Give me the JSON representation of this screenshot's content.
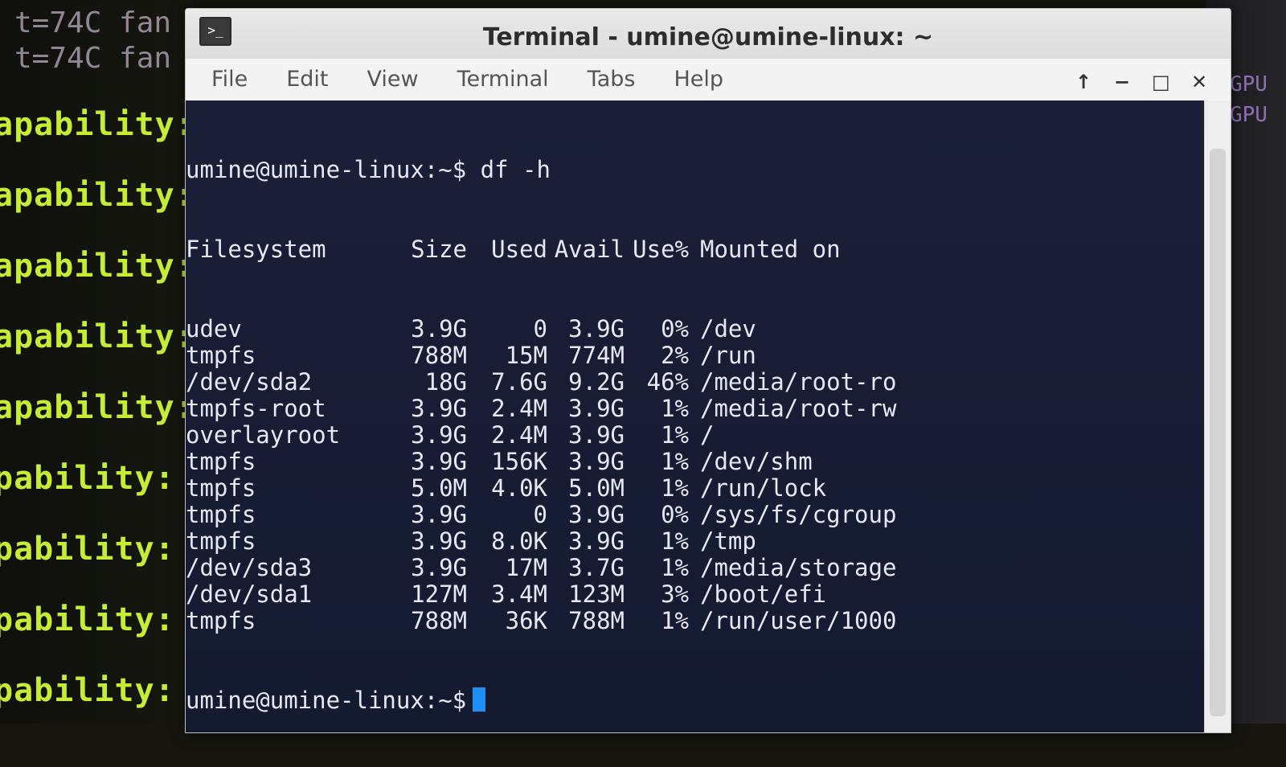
{
  "background": {
    "top_lines": [
      "t=74C fan",
      "t=74C fan"
    ],
    "capability_lines": [
      "apability:",
      "apability:",
      "apability:",
      "apability:",
      "apability:",
      "pability:",
      "pability:",
      "pability:",
      "pability:"
    ],
    "right_text": [
      "GPU",
      "GPU"
    ]
  },
  "window": {
    "title": "Terminal - umine@umine-linux: ~",
    "controls": [
      "↑",
      "−",
      "□",
      "✕"
    ],
    "menu": [
      "File",
      "Edit",
      "View",
      "Terminal",
      "Tabs",
      "Help"
    ]
  },
  "terminal": {
    "command_line": "umine@umine-linux:~$ df -h",
    "header": {
      "fs": "Filesystem",
      "size": "Size",
      "used": "Used",
      "avail": "Avail",
      "use": "Use%",
      "mnt": "Mounted on"
    },
    "rows": [
      {
        "fs": "udev",
        "size": "3.9G",
        "used": "0",
        "avail": "3.9G",
        "use": "0%",
        "mnt": "/dev"
      },
      {
        "fs": "tmpfs",
        "size": "788M",
        "used": "15M",
        "avail": "774M",
        "use": "2%",
        "mnt": "/run"
      },
      {
        "fs": "/dev/sda2",
        "size": "18G",
        "used": "7.6G",
        "avail": "9.2G",
        "use": "46%",
        "mnt": "/media/root-ro"
      },
      {
        "fs": "tmpfs-root",
        "size": "3.9G",
        "used": "2.4M",
        "avail": "3.9G",
        "use": "1%",
        "mnt": "/media/root-rw"
      },
      {
        "fs": "overlayroot",
        "size": "3.9G",
        "used": "2.4M",
        "avail": "3.9G",
        "use": "1%",
        "mnt": "/"
      },
      {
        "fs": "tmpfs",
        "size": "3.9G",
        "used": "156K",
        "avail": "3.9G",
        "use": "1%",
        "mnt": "/dev/shm"
      },
      {
        "fs": "tmpfs",
        "size": "5.0M",
        "used": "4.0K",
        "avail": "5.0M",
        "use": "1%",
        "mnt": "/run/lock"
      },
      {
        "fs": "tmpfs",
        "size": "3.9G",
        "used": "0",
        "avail": "3.9G",
        "use": "0%",
        "mnt": "/sys/fs/cgroup"
      },
      {
        "fs": "tmpfs",
        "size": "3.9G",
        "used": "8.0K",
        "avail": "3.9G",
        "use": "1%",
        "mnt": "/tmp"
      },
      {
        "fs": "/dev/sda3",
        "size": "3.9G",
        "used": "17M",
        "avail": "3.7G",
        "use": "1%",
        "mnt": "/media/storage"
      },
      {
        "fs": "/dev/sda1",
        "size": "127M",
        "used": "3.4M",
        "avail": "123M",
        "use": "3%",
        "mnt": "/boot/efi"
      },
      {
        "fs": "tmpfs",
        "size": "788M",
        "used": "36K",
        "avail": "788M",
        "use": "1%",
        "mnt": "/run/user/1000"
      }
    ],
    "prompt": "umine@umine-linux:~$"
  },
  "colors": {
    "terminal_bg": "#1b1f38",
    "cursor": "#1d8ff5",
    "bg_text_green": "#c6ec35",
    "bg_text_purple": "#8d6fb8"
  }
}
